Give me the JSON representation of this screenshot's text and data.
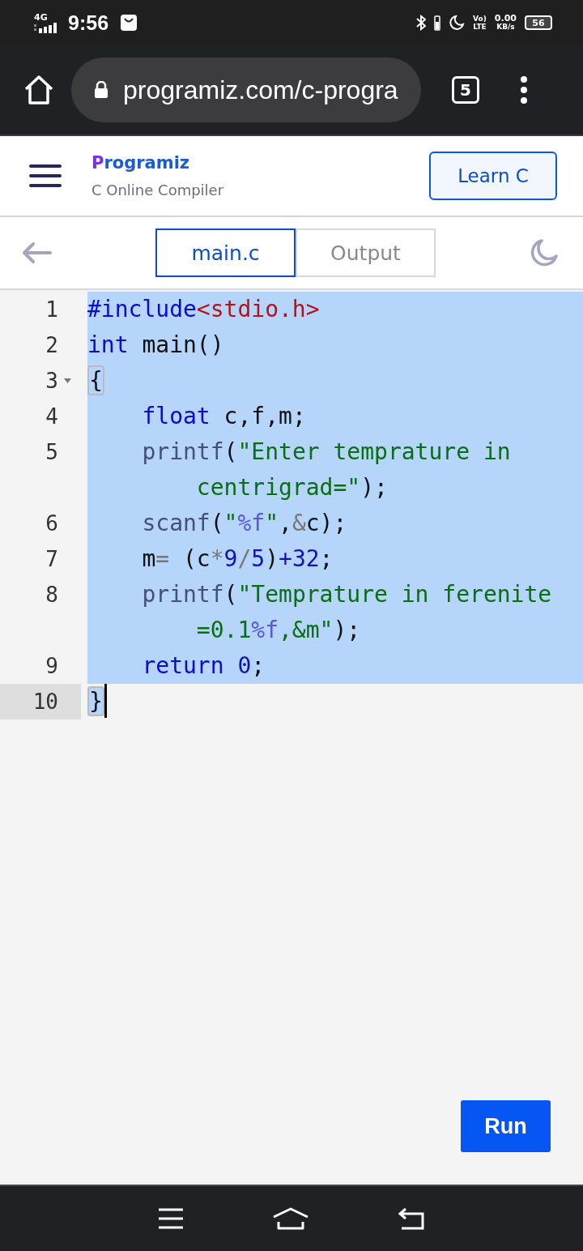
{
  "status_bar": {
    "network": "4G",
    "time": "9:56",
    "volte": "Vo)",
    "lte": "LTE",
    "speed": "0.00",
    "speed_unit": "KB/s",
    "battery": "56"
  },
  "browser": {
    "url": "programiz.com/c-progra",
    "tab_count": "5"
  },
  "header": {
    "logo": "Programiz",
    "subtitle": "C Online Compiler",
    "button": "Learn C"
  },
  "tabs": [
    {
      "label": "main.c",
      "selected": true
    },
    {
      "label": "Output",
      "selected": false
    }
  ],
  "editor": {
    "lines": [
      {
        "number": "1",
        "selected": true,
        "active": false,
        "foldable": false,
        "cursor": false,
        "tokens": [
          {
            "kind": "keyword",
            "text": "#include"
          },
          {
            "kind": "include",
            "text": "<stdio.h>"
          }
        ]
      },
      {
        "number": "2",
        "selected": true,
        "active": false,
        "foldable": false,
        "cursor": false,
        "tokens": [
          {
            "kind": "keyword",
            "text": "int"
          },
          {
            "kind": "plain",
            "text": " main()"
          }
        ]
      },
      {
        "number": "3",
        "selected": true,
        "active": false,
        "foldable": true,
        "cursor": false,
        "tokens": [
          {
            "kind": "bracket",
            "text": "{"
          }
        ]
      },
      {
        "number": "4",
        "selected": true,
        "active": false,
        "foldable": false,
        "cursor": false,
        "tokens": [
          {
            "kind": "keyword",
            "text": "    float"
          },
          {
            "kind": "plain",
            "text": " c,f,m;"
          }
        ]
      },
      {
        "number": "5",
        "selected": true,
        "active": false,
        "foldable": false,
        "cursor": false,
        "tokens": [
          {
            "kind": "builtin",
            "text": "    printf"
          },
          {
            "kind": "plain",
            "text": "("
          },
          {
            "kind": "string",
            "text": "\"Enter temprature in centrigrad=\""
          },
          {
            "kind": "plain",
            "text": ");"
          }
        ]
      },
      {
        "number": "6",
        "selected": true,
        "active": false,
        "foldable": false,
        "cursor": false,
        "tokens": [
          {
            "kind": "builtin",
            "text": "    scanf"
          },
          {
            "kind": "plain",
            "text": "("
          },
          {
            "kind": "string",
            "text": "\""
          },
          {
            "kind": "format",
            "text": "%f"
          },
          {
            "kind": "string",
            "text": "\""
          },
          {
            "kind": "plain",
            "text": ","
          },
          {
            "kind": "operator",
            "text": "&"
          },
          {
            "kind": "plain",
            "text": "c);"
          }
        ]
      },
      {
        "number": "7",
        "selected": true,
        "active": false,
        "foldable": false,
        "cursor": false,
        "tokens": [
          {
            "kind": "plain",
            "text": "    m"
          },
          {
            "kind": "operator",
            "text": "="
          },
          {
            "kind": "plain",
            "text": " (c"
          },
          {
            "kind": "operator",
            "text": "*"
          },
          {
            "kind": "number",
            "text": "9"
          },
          {
            "kind": "operator",
            "text": "/"
          },
          {
            "kind": "number",
            "text": "5"
          },
          {
            "kind": "plain",
            "text": ")"
          },
          {
            "kind": "number",
            "text": "+32"
          },
          {
            "kind": "plain",
            "text": ";"
          }
        ]
      },
      {
        "number": "8",
        "selected": true,
        "active": false,
        "foldable": false,
        "cursor": false,
        "tokens": [
          {
            "kind": "builtin",
            "text": "    printf"
          },
          {
            "kind": "plain",
            "text": "("
          },
          {
            "kind": "string",
            "text": "\"Temprature in ferenite =0.1"
          },
          {
            "kind": "format",
            "text": "%f"
          },
          {
            "kind": "string",
            "text": ",&m\""
          },
          {
            "kind": "plain",
            "text": ");"
          }
        ]
      },
      {
        "number": "9",
        "selected": true,
        "active": false,
        "foldable": false,
        "cursor": false,
        "tokens": [
          {
            "kind": "keyword",
            "text": "    return"
          },
          {
            "kind": "number",
            "text": " 0"
          },
          {
            "kind": "plain",
            "text": ";"
          }
        ]
      },
      {
        "number": "10",
        "selected": false,
        "active": true,
        "foldable": false,
        "cursor": true,
        "tokens": [
          {
            "kind": "bracket",
            "text": "}"
          }
        ]
      }
    ]
  },
  "run_button": "Run"
}
